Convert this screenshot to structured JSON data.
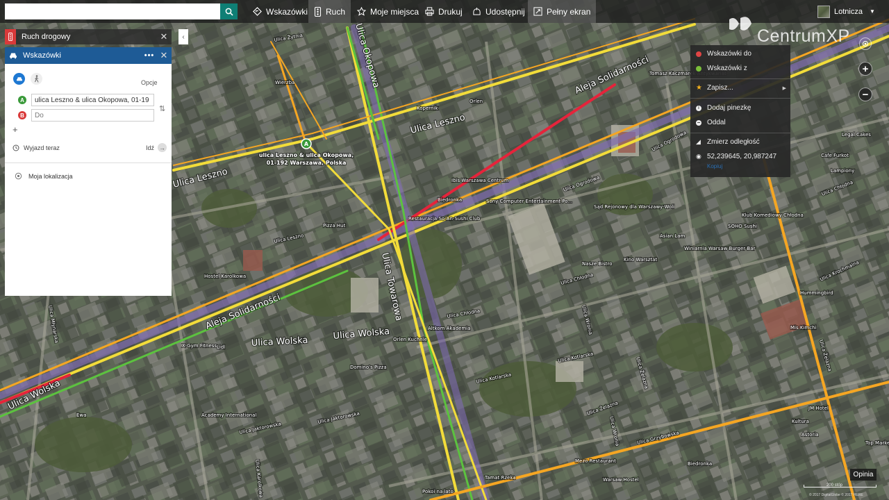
{
  "toolbar": {
    "search_placeholder": "",
    "buttons": [
      {
        "label": "Wskazówki",
        "icon": "directions-icon"
      },
      {
        "label": "Ruch",
        "icon": "traffic-icon",
        "active": true
      },
      {
        "label": "Moje miejsca",
        "icon": "star-icon"
      },
      {
        "label": "Drukuj",
        "icon": "print-icon"
      },
      {
        "label": "Udostępnij",
        "icon": "share-icon"
      },
      {
        "label": "Pełny ekran",
        "icon": "fullscreen-icon"
      }
    ],
    "map_style": "Lotnicza"
  },
  "traffic_panel": {
    "title": "Ruch drogowy"
  },
  "directions": {
    "title": "Wskazówki",
    "options_label": "Opcje",
    "from_marker": "A",
    "from_value": "ulica Leszno & ulica Okopowa, 01-19",
    "to_marker": "B",
    "to_placeholder": "Do",
    "depart_label": "Wyjazd teraz",
    "go_label": "Idź",
    "my_location": "Moja lokalizacja"
  },
  "context_menu": {
    "items": [
      {
        "label": "Wskazówki do",
        "color": "#e04545"
      },
      {
        "label": "Wskazówki z",
        "color": "#7bbf3a"
      },
      {
        "label": "Zapisz...",
        "icon": "star-icon"
      },
      {
        "label": "Dodaj pinezkę",
        "icon": "info-icon"
      },
      {
        "label": "Oddal",
        "icon": "zoom-out-icon"
      },
      {
        "label": "Zmierz odległość",
        "icon": "ruler-icon"
      },
      {
        "label": "52,239645, 20,987247",
        "icon": "location-icon"
      }
    ],
    "copy_label": "Kopiuj"
  },
  "map": {
    "pin_label": "A",
    "pin_caption": [
      "ulica Leszno & ulica Okopowa,",
      "01-192 Warszawa, Polska"
    ],
    "streets": [
      "Ulica Okopowa",
      "Ulica Leszno",
      "Ulica Leszno",
      "Aleja Solidarności",
      "Aleja Solidarności",
      "Ulica Towarowa",
      "Ulica Wolska",
      "Ulica Wolska",
      "Ulica Wolska",
      "Ulica Żytnia",
      "Ulica Ogrodowa",
      "Ulica Ogrodowa",
      "Ulica Chłodna",
      "Ulica Chłodna",
      "Ulica Chłodna",
      "Ulica Kotlarska",
      "Ulica Kotlarska",
      "Ulica Żelazna",
      "Ulica Żelazna",
      "Ulica Żelazna",
      "Ulica Grzybowska",
      "Ulica Krochmalna",
      "Ulica Jaktorowska",
      "Ulica Jaktorowska",
      "Ulica Karolkowa",
      "Ulica Młynarska",
      "Ulica Wronia",
      "Ulica Wronia",
      "Ulica Leszno"
    ],
    "pois": [
      "Ibis Warszawa Centrum",
      "Biedronka",
      "Restauracja So-An-Sushi Club",
      "Sony Computer Entertainment Po...",
      "Pizza Hut",
      "Orlen",
      "Kopernik",
      "Tomasz Kaczmarek Antykwariat",
      "Sąd Rejonowy dla Warszawy-Woli",
      "Nasze Bistro",
      "Kino Warsztat",
      "Winiarnia Warsaw Burger Bar",
      "Asian Lam",
      "SOHO Sushi",
      "Klub Komediowy Chłodna",
      "Altkom Akademia",
      "Domino's Pizza",
      "Orlen Kuchnie",
      "X-Gym Fitness",
      "Lidl",
      "Academy International",
      "Hostel Karolkowa",
      "Legal Cakes",
      "Cafe Furkot",
      "Lampiony",
      "Hummingbird",
      "Mis Kimchi",
      "JM Hotel",
      "Kultura",
      "Astoria",
      "Top Market",
      "Mezo Restaurant",
      "Warsaw Hostel",
      "Biedronka",
      "Tamat Rzeka",
      "Pokoi na lato",
      "Ewa",
      "Wierzba"
    ]
  },
  "watermark": "CentrumXP",
  "feedback": "Opinia",
  "scale": "200 stóp",
  "copyright": "© 2017 DigitalGlobe  © 2017 HERE",
  "colors": {
    "topbar": "#1e1e1e",
    "panel_header": "#1e5b96",
    "search_button": "#0f7f75",
    "traffic_badge": "#d93a3a",
    "drive_mode": "#1e78d2",
    "road_yellow": "#f2dc3a",
    "road_orange": "#f5a623",
    "road_green": "#5cc23f",
    "road_red": "#e5243b",
    "road_purple": "#8a6fbf"
  }
}
